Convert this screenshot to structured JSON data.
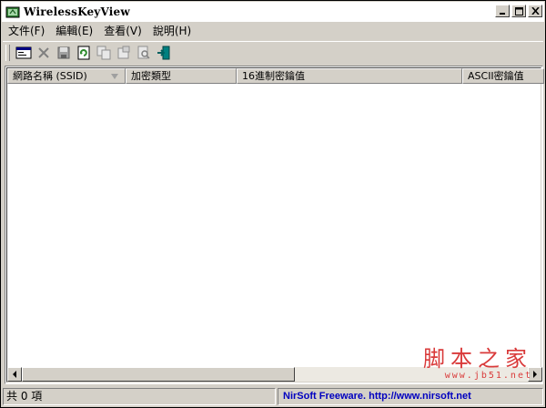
{
  "window": {
    "title": "WirelessKeyView",
    "controls": {
      "minimize": "_",
      "maximize": "□",
      "close": "×"
    }
  },
  "menu": [
    "文件(F)",
    "編輯(E)",
    "查看(V)",
    "說明(H)"
  ],
  "toolbar": {
    "icons": [
      "properties-icon",
      "delete-icon",
      "save-icon",
      "refresh-icon",
      "copy-icon",
      "html-report-icon",
      "find-icon",
      "exit-icon"
    ]
  },
  "list": {
    "columns": [
      "網路名稱 (SSID)",
      "加密類型",
      "16進制密鑰值",
      "ASCII密鑰值"
    ],
    "rows": []
  },
  "status": {
    "count": "共 0 項",
    "credit": "NirSoft Freeware.  http://www.nirsoft.net"
  },
  "watermark": {
    "text": "脚本之家",
    "url": "www.jb51.net"
  },
  "colors": {
    "face": "#d4d0c8",
    "link": "#0000c0",
    "watermark": "#d93a3a"
  }
}
